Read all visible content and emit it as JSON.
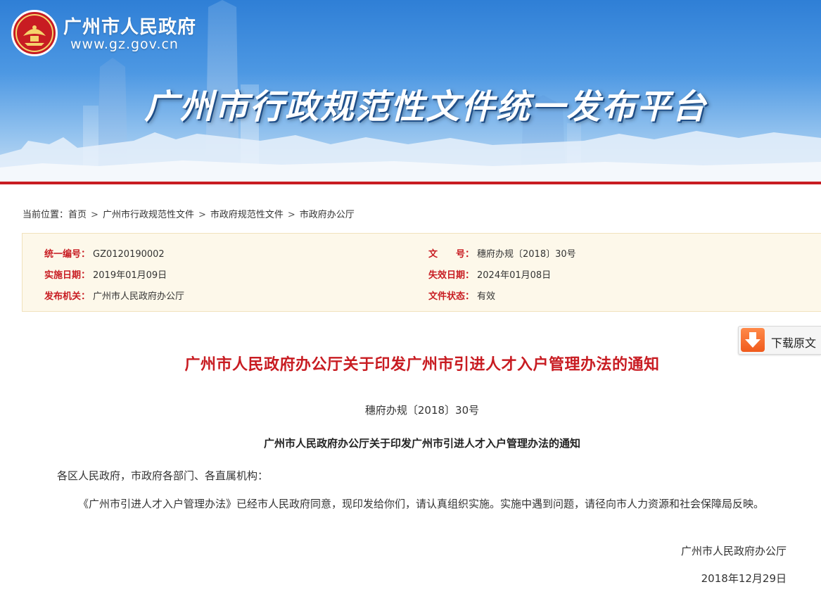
{
  "header": {
    "site_name": "广州市人民政府",
    "site_url": "www.gz.gov.cn",
    "platform_title": "广州市行政规范性文件统一发布平台"
  },
  "breadcrumb": {
    "prefix": "当前位置：",
    "items": [
      "首页",
      "广州市行政规范性文件",
      "市政府规范性文件",
      "市政府办公厅"
    ],
    "separator": ">"
  },
  "meta": {
    "unified_no": {
      "label": "统一编号：",
      "value": "GZ0120190002"
    },
    "doc_no": {
      "label": "文　　号：",
      "value": "穗府办规〔2018〕30号"
    },
    "effective_date": {
      "label": "实施日期：",
      "value": "2019年01月09日"
    },
    "expiry_date": {
      "label": "失效日期：",
      "value": "2024年01月08日"
    },
    "issuer": {
      "label": "发布机关：",
      "value": "广州市人民政府办公厅"
    },
    "status": {
      "label": "文件状态：",
      "value": "有效"
    }
  },
  "download": {
    "label": "下载原文"
  },
  "document": {
    "title": "广州市人民政府办公厅关于印发广州市引进人才入户管理办法的通知",
    "number": "穗府办规〔2018〕30号",
    "subtitle": "广州市人民政府办公厅关于印发广州市引进人才入户管理办法的通知",
    "addressee": "各区人民政府，市政府各部门、各直属机构：",
    "body": "《广州市引进人才入户管理办法》已经市人民政府同意，现印发给你们，请认真组织实施。实施中遇到问题，请径向市人力资源和社会保障局反映。",
    "signature": "广州市人民政府办公厅",
    "date": "2018年12月29日"
  },
  "colors": {
    "accent_red": "#c81c22",
    "meta_bg": "#fdf8ea",
    "banner_blue": "#2f7fd6"
  }
}
